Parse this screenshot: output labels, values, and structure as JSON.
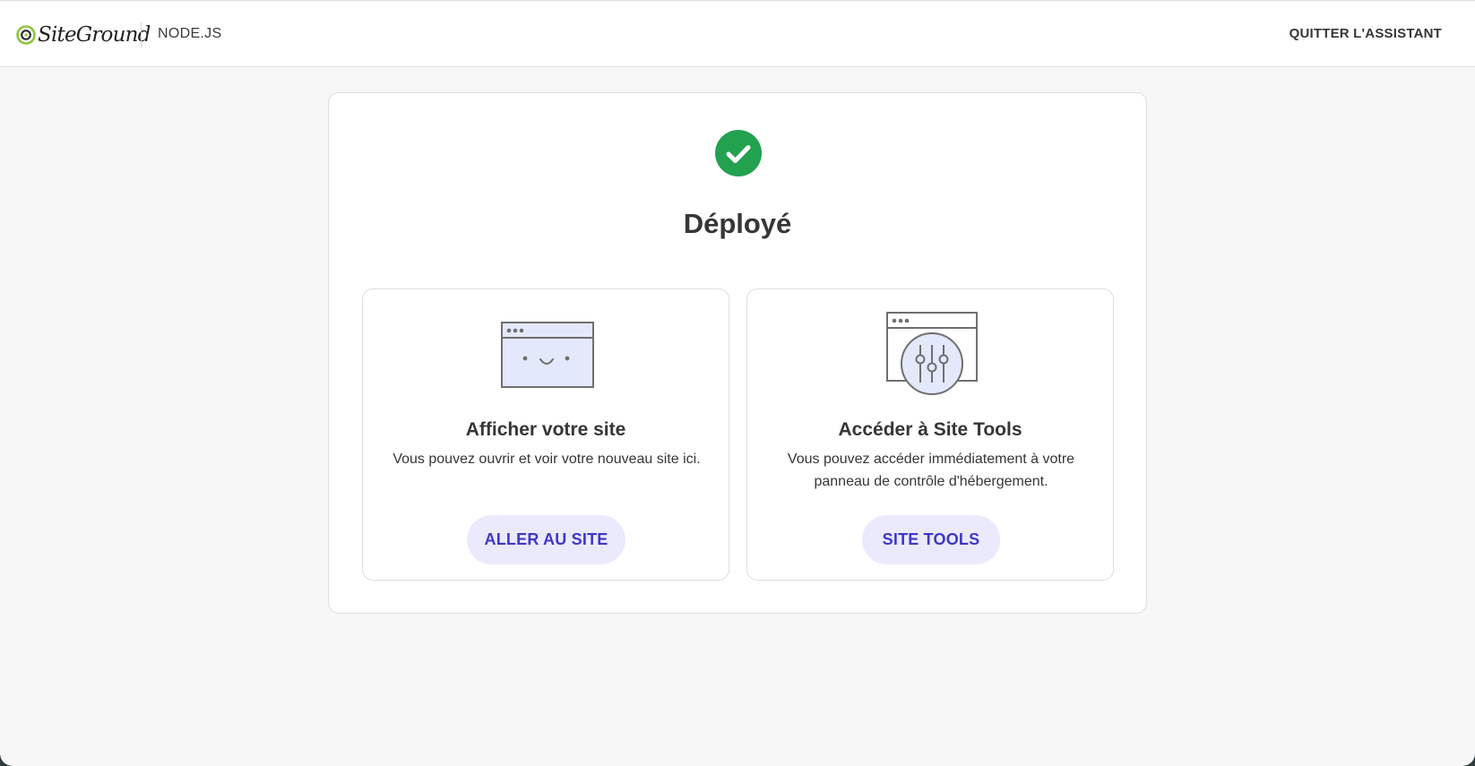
{
  "header": {
    "logo_text": "SiteGround",
    "product_label": "NODE.JS",
    "exit_label": "QUITTER L'ASSISTANT"
  },
  "panel": {
    "status_icon": "check-circle-icon",
    "title": "Déployé"
  },
  "cards": [
    {
      "illustration": "browser-window-smiley-icon",
      "title": "Afficher votre site",
      "description": "Vous pouvez ouvrir et voir votre nouveau site ici.",
      "button_label": "ALLER AU SITE"
    },
    {
      "illustration": "browser-window-sliders-icon",
      "title": "Accéder à Site Tools",
      "description": "Vous pouvez accéder immédiatement à votre panneau de contrôle d'hébergement.",
      "button_label": "SITE TOOLS"
    }
  ],
  "colors": {
    "success": "#22a14f",
    "button_bg": "#ebeafd",
    "button_text": "#3e37c9",
    "illustration_fill": "#e4e8fb",
    "illustration_stroke": "#6f6f6f",
    "logo_green": "#8dc63f"
  }
}
